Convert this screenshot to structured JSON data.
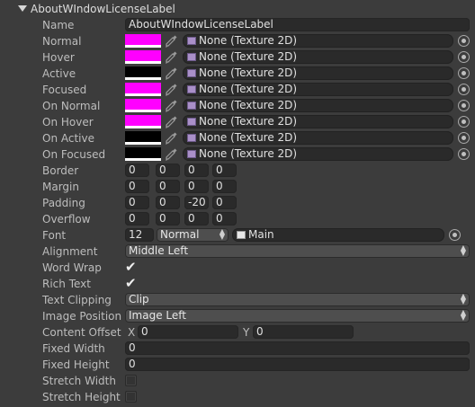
{
  "header": {
    "title": "AboutWIndowLicenseLabel"
  },
  "name": {
    "label": "Name",
    "value": "AboutWIndowLicenseLabel"
  },
  "states": [
    {
      "label": "Normal",
      "color": "#ff00ff",
      "bar": "#ffffff",
      "texture": "None (Texture 2D)"
    },
    {
      "label": "Hover",
      "color": "#ff00ff",
      "bar": "#ffffff",
      "texture": "None (Texture 2D)"
    },
    {
      "label": "Active",
      "color": "#000000",
      "bar": "#ffffff",
      "texture": "None (Texture 2D)"
    },
    {
      "label": "Focused",
      "color": "#ff00ff",
      "bar": "#ffffff",
      "texture": "None (Texture 2D)"
    },
    {
      "label": "On Normal",
      "color": "#ff00ff",
      "bar": "#ffffff",
      "texture": "None (Texture 2D)"
    },
    {
      "label": "On Hover",
      "color": "#ff00ff",
      "bar": "#ffffff",
      "texture": "None (Texture 2D)"
    },
    {
      "label": "On Active",
      "color": "#000000",
      "bar": "#ffffff",
      "texture": "None (Texture 2D)"
    },
    {
      "label": "On Focused",
      "color": "#000000",
      "bar": "#ffffff",
      "texture": "None (Texture 2D)"
    }
  ],
  "offsets": [
    {
      "label": "Border",
      "values": [
        "0",
        "0",
        "0",
        "0"
      ]
    },
    {
      "label": "Margin",
      "values": [
        "0",
        "0",
        "0",
        "0"
      ]
    },
    {
      "label": "Padding",
      "values": [
        "0",
        "0",
        "-20",
        "0"
      ]
    },
    {
      "label": "Overflow",
      "values": [
        "0",
        "0",
        "0",
        "0"
      ]
    }
  ],
  "font": {
    "label": "Font",
    "size": "12",
    "style": "Normal",
    "asset": "Main"
  },
  "alignment": {
    "label": "Alignment",
    "value": "Middle Left"
  },
  "word_wrap": {
    "label": "Word Wrap",
    "checked": true,
    "mark": "✔"
  },
  "rich_text": {
    "label": "Rich Text",
    "checked": true,
    "mark": "✔"
  },
  "text_clipping": {
    "label": "Text Clipping",
    "value": "Clip"
  },
  "image_position": {
    "label": "Image Position",
    "value": "Image Left"
  },
  "content_offset": {
    "label": "Content Offset",
    "x_label": "X",
    "x": "0",
    "y_label": "Y",
    "y": "0"
  },
  "fixed_width": {
    "label": "Fixed Width",
    "value": "0"
  },
  "fixed_height": {
    "label": "Fixed Height",
    "value": "0"
  },
  "stretch_width": {
    "label": "Stretch Width",
    "checked": false
  },
  "stretch_height": {
    "label": "Stretch Height",
    "checked": false
  },
  "icons": {
    "foldout": "triangle-down-icon",
    "picker": "eyedropper-icon",
    "texture": "texture-icon",
    "object_picker": "object-picker-icon",
    "font_asset": "font-asset-icon"
  }
}
